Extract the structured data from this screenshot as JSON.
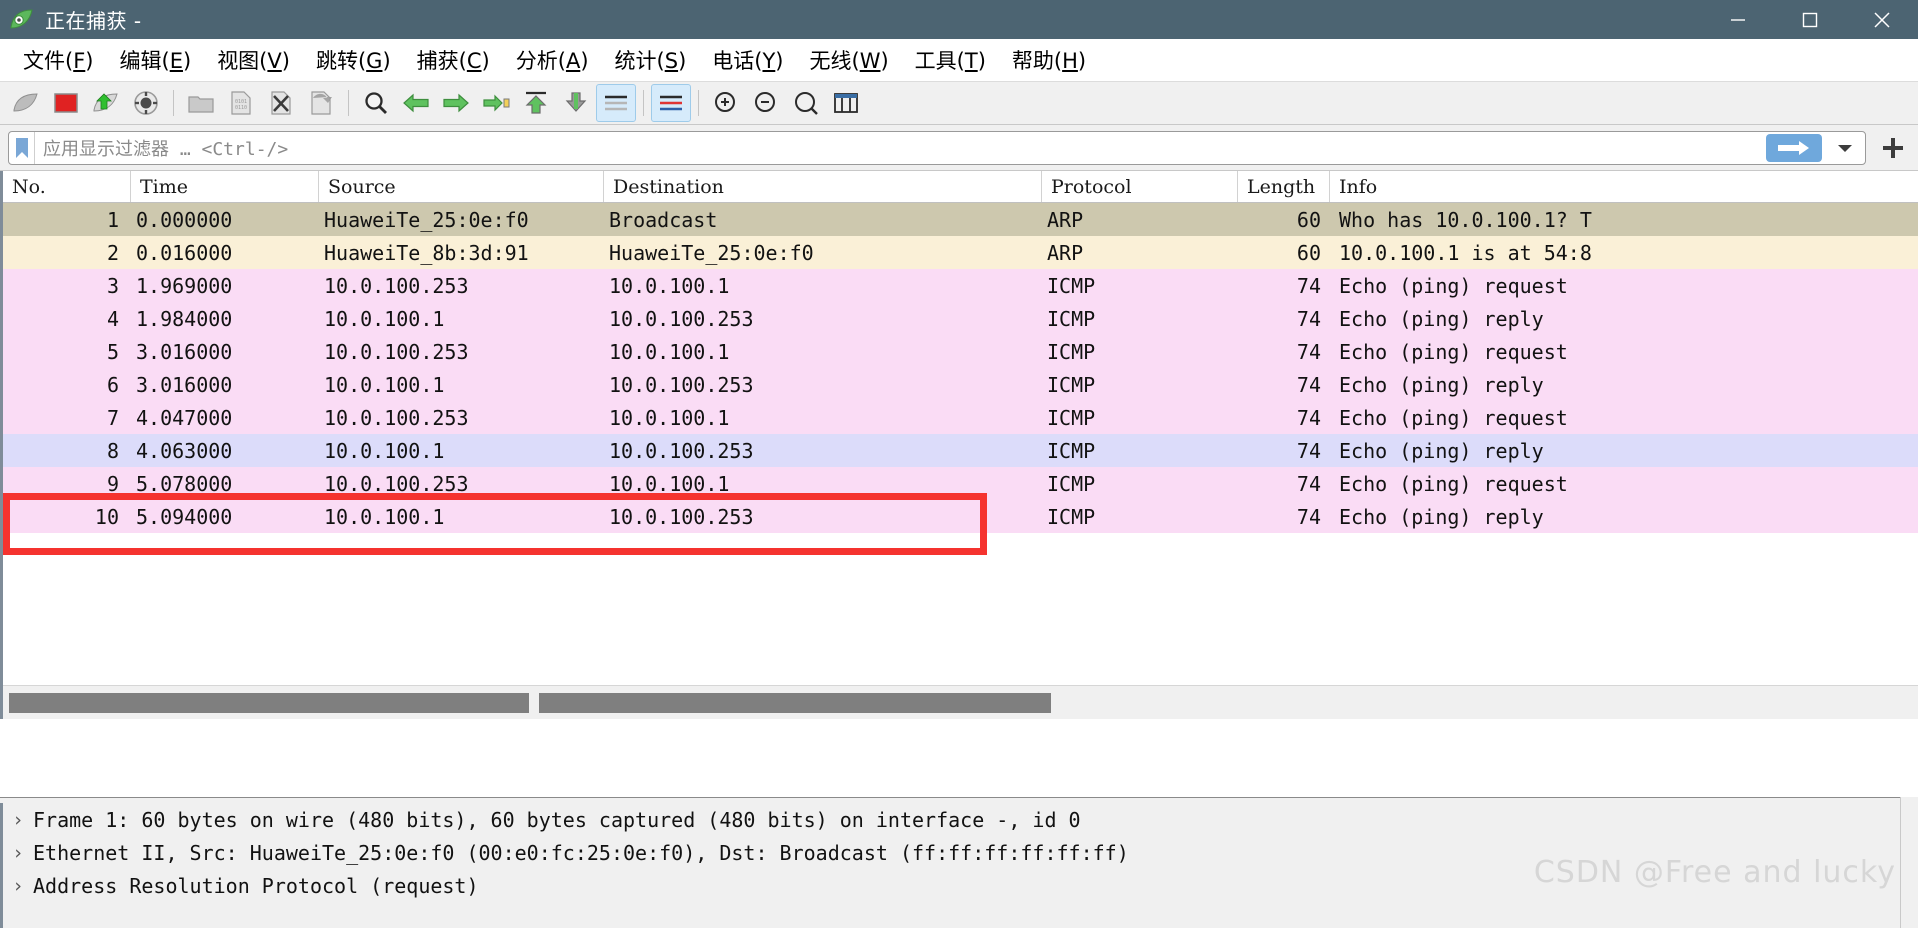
{
  "window": {
    "title": "正在捕获 -",
    "app_icon": "wireshark-fin-icon",
    "minimize_label": "−",
    "maximize_label": "□",
    "close_label": "✕",
    "titlebar_color": "#4c6472"
  },
  "menu": {
    "items": [
      {
        "name": "file",
        "label": "文件(F)",
        "pre": "文件(",
        "key": "F",
        "post": ")"
      },
      {
        "name": "edit",
        "label": "编辑(E)",
        "pre": "编辑(",
        "key": "E",
        "post": ")"
      },
      {
        "name": "view",
        "label": "视图(V)",
        "pre": "视图(",
        "key": "V",
        "post": ")"
      },
      {
        "name": "go",
        "label": "跳转(G)",
        "pre": "跳转(",
        "key": "G",
        "post": ")"
      },
      {
        "name": "capture",
        "label": "捕获(C)",
        "pre": "捕获(",
        "key": "C",
        "post": ")"
      },
      {
        "name": "analyze",
        "label": "分析(A)",
        "pre": "分析(",
        "key": "A",
        "post": ")"
      },
      {
        "name": "statistics",
        "label": "统计(S)",
        "pre": "统计(",
        "key": "S",
        "post": ")"
      },
      {
        "name": "telephony",
        "label": "电话(Y)",
        "pre": "电话(",
        "key": "Y",
        "post": ")"
      },
      {
        "name": "wireless",
        "label": "无线(W)",
        "pre": "无线(",
        "key": "W",
        "post": ")"
      },
      {
        "name": "tools",
        "label": "工具(T)",
        "pre": "工具(",
        "key": "T",
        "post": ")"
      },
      {
        "name": "help",
        "label": "帮助(H)",
        "pre": "帮助(",
        "key": "H",
        "post": ")"
      }
    ]
  },
  "toolbar": {
    "buttons": [
      {
        "name": "start-capture-icon",
        "icon": "shark-fin-grey"
      },
      {
        "name": "stop-capture-icon",
        "icon": "stop-square-red"
      },
      {
        "name": "restart-capture-icon",
        "icon": "shark-fin-green-arrow"
      },
      {
        "name": "capture-options-icon",
        "icon": "gear-circle"
      },
      {
        "sep": true
      },
      {
        "name": "open-file-icon",
        "icon": "folder"
      },
      {
        "name": "save-file-icon",
        "icon": "document-0101"
      },
      {
        "name": "close-file-icon",
        "icon": "document-x"
      },
      {
        "name": "reload-file-icon",
        "icon": "document-reload"
      },
      {
        "sep": true
      },
      {
        "name": "find-packet-icon",
        "icon": "magnifier"
      },
      {
        "name": "go-back-icon",
        "icon": "arrow-left-green"
      },
      {
        "name": "go-forward-icon",
        "icon": "arrow-right-green"
      },
      {
        "name": "go-to-packet-icon",
        "icon": "arrow-right-to-bar"
      },
      {
        "name": "go-to-first-icon",
        "icon": "arrow-up-to-bar"
      },
      {
        "name": "go-to-last-icon",
        "icon": "arrow-down-to-bar"
      },
      {
        "name": "auto-scroll-icon",
        "icon": "lines-grey",
        "active": true
      },
      {
        "sep": true
      },
      {
        "name": "colorize-icon",
        "icon": "lines-colored",
        "active": true
      },
      {
        "sep": true
      },
      {
        "name": "zoom-in-icon",
        "icon": "magnifier-plus"
      },
      {
        "name": "zoom-out-icon",
        "icon": "magnifier-minus"
      },
      {
        "name": "zoom-reset-icon",
        "icon": "magnifier-reset"
      },
      {
        "name": "resize-columns-icon",
        "icon": "resize-columns"
      }
    ]
  },
  "filter": {
    "bookmark_icon": "bookmark-icon",
    "value": "",
    "placeholder": "应用显示过滤器 … <Ctrl-/>",
    "apply_icon": "arrow-right-icon",
    "dropdown_icon": "chevron-down-icon",
    "add_icon": "plus-icon",
    "apply_color": "#6fa8dc"
  },
  "packet_list": {
    "columns": [
      {
        "name": "no",
        "label": "No."
      },
      {
        "name": "time",
        "label": "Time"
      },
      {
        "name": "source",
        "label": "Source"
      },
      {
        "name": "destination",
        "label": "Destination"
      },
      {
        "name": "protocol",
        "label": "Protocol"
      },
      {
        "name": "length",
        "label": "Length"
      },
      {
        "name": "info",
        "label": "Info"
      }
    ],
    "rows": [
      {
        "no": "1",
        "time": "0.000000",
        "source": "HuaweiTe_25:0e:f0",
        "destination": "Broadcast",
        "protocol": "ARP",
        "length": "60",
        "info": "Who has 10.0.100.1? T",
        "bg": "#cdc8ae"
      },
      {
        "no": "2",
        "time": "0.016000",
        "source": "HuaweiTe_8b:3d:91",
        "destination": "HuaweiTe_25:0e:f0",
        "protocol": "ARP",
        "length": "60",
        "info": "10.0.100.1 is at 54:8",
        "bg": "#faf0d7"
      },
      {
        "no": "3",
        "time": "1.969000",
        "source": "10.0.100.253",
        "destination": "10.0.100.1",
        "protocol": "ICMP",
        "length": "74",
        "info": "Echo (ping) request",
        "bg": "#fadcf5"
      },
      {
        "no": "4",
        "time": "1.984000",
        "source": "10.0.100.1",
        "destination": "10.0.100.253",
        "protocol": "ICMP",
        "length": "74",
        "info": "Echo (ping) reply",
        "bg": "#fadcf5"
      },
      {
        "no": "5",
        "time": "3.016000",
        "source": "10.0.100.253",
        "destination": "10.0.100.1",
        "protocol": "ICMP",
        "length": "74",
        "info": "Echo (ping) request",
        "bg": "#fadcf5"
      },
      {
        "no": "6",
        "time": "3.016000",
        "source": "10.0.100.1",
        "destination": "10.0.100.253",
        "protocol": "ICMP",
        "length": "74",
        "info": "Echo (ping) reply",
        "bg": "#fadcf5"
      },
      {
        "no": "7",
        "time": "4.047000",
        "source": "10.0.100.253",
        "destination": "10.0.100.1",
        "protocol": "ICMP",
        "length": "74",
        "info": "Echo (ping) request",
        "bg": "#fadcf5"
      },
      {
        "no": "8",
        "time": "4.063000",
        "source": "10.0.100.1",
        "destination": "10.0.100.253",
        "protocol": "ICMP",
        "length": "74",
        "info": "Echo (ping) reply",
        "bg": "#dcdcfa"
      },
      {
        "no": "9",
        "time": "5.078000",
        "source": "10.0.100.253",
        "destination": "10.0.100.1",
        "protocol": "ICMP",
        "length": "74",
        "info": "Echo (ping) request",
        "bg": "#fadcf5"
      },
      {
        "no": "10",
        "time": "5.094000",
        "source": "10.0.100.1",
        "destination": "10.0.100.253",
        "protocol": "ICMP",
        "length": "74",
        "info": "Echo (ping) reply",
        "bg": "#fadcf5"
      }
    ],
    "annotation": {
      "name": "red-highlight-box",
      "color": "#f5332f",
      "target_row": "3"
    }
  },
  "packet_detail": {
    "rows": [
      {
        "name": "frame-node",
        "triangle": "›",
        "text": "Frame 1: 60 bytes on wire (480 bits), 60 bytes captured (480 bits) on interface -, id 0"
      },
      {
        "name": "ethernet-node",
        "triangle": "›",
        "text": "Ethernet II, Src: HuaweiTe_25:0e:f0 (00:e0:fc:25:0e:f0), Dst: Broadcast (ff:ff:ff:ff:ff:ff)"
      },
      {
        "name": "arp-node",
        "triangle": "›",
        "text": "Address Resolution Protocol (request)"
      }
    ]
  },
  "watermark": {
    "text": "CSDN @Free and lucky"
  }
}
